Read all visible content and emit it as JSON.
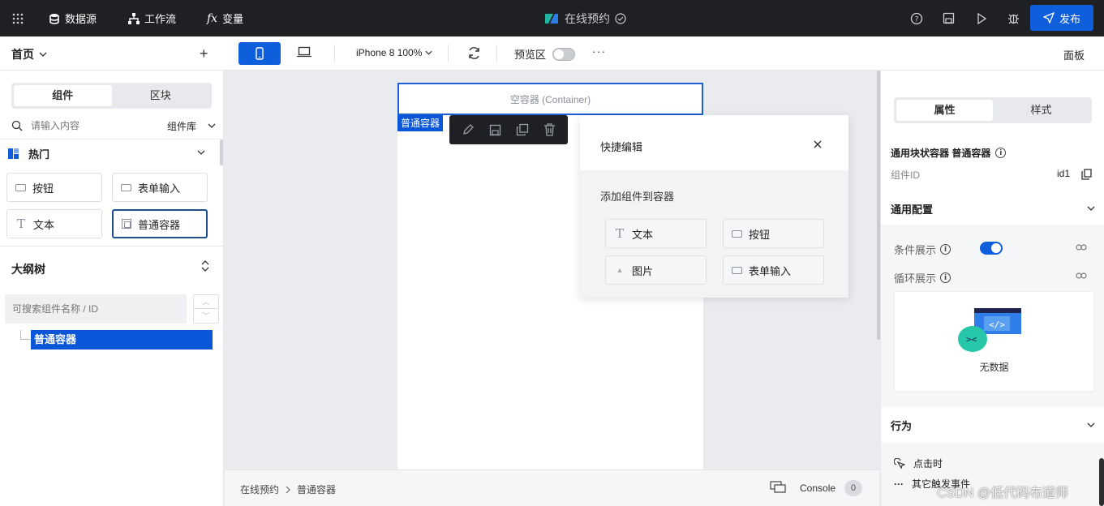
{
  "topbar": {
    "datasource": "数据源",
    "workflow": "工作流",
    "variables": "变量",
    "app_title": "在线预约",
    "publish": "发布"
  },
  "toolbar": {
    "page": "首页",
    "device": "iPhone 8 100%",
    "preview_label": "预览区",
    "more": "···",
    "panel": "面板"
  },
  "left": {
    "tabs": [
      "组件",
      "区块"
    ],
    "search_placeholder": "请输入内容",
    "library": "组件库",
    "hot": "热门",
    "components": [
      "按钮",
      "表单输入",
      "文本",
      "普通容器"
    ],
    "outline_title": "大纲树",
    "outline_search_placeholder": "可搜索组件名称 / ID",
    "outline_node": "普通容器"
  },
  "canvas": {
    "container_placeholder": "空容器 (Container)",
    "selected_tag": "普通容器"
  },
  "quick_edit": {
    "title": "快捷编辑",
    "subtitle": "添加组件到容器",
    "items": [
      "文本",
      "按钮",
      "图片",
      "表单输入"
    ]
  },
  "bottom": {
    "crumb1": "在线预约",
    "crumb2": "普通容器",
    "console": "Console",
    "console_count": "0"
  },
  "right": {
    "tabs": [
      "属性",
      "样式"
    ],
    "component_title": "通用块状容器 普通容器",
    "id_label": "组件ID",
    "id_value": "id1",
    "general": "通用配置",
    "conditional": "条件展示",
    "loop": "循环展示",
    "empty": "无数据",
    "behavior": "行为",
    "on_click": "点击时",
    "other_events": "其它触发事件"
  },
  "watermark": "CSDN @低代码布道师",
  "colors": {
    "accent": "#0f5fdc",
    "topbar": "#1f2024",
    "selected_node": "#0a56d8"
  }
}
